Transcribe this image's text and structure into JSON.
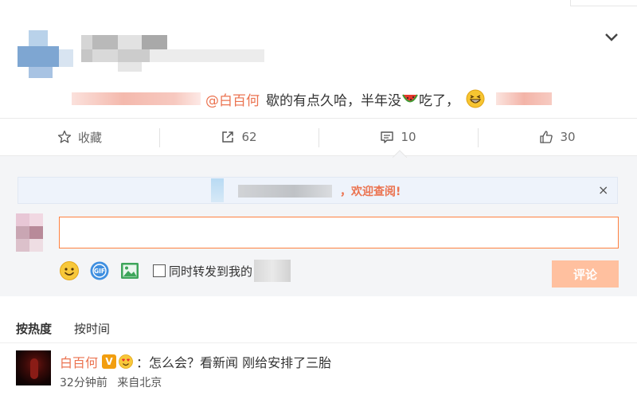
{
  "post": {
    "mention": "@白百何",
    "text_before_emoji": "歇的有点久哈，半年没",
    "emoji_watermelon": "watermelon-emoji",
    "text_after_emoji": "吃了，",
    "emoji_grin": "grin-emoji"
  },
  "actions": {
    "favorite_label": "收藏",
    "share_count": "62",
    "comment_count": "10",
    "like_count": "30"
  },
  "comment_box": {
    "notice_text": "，欢迎查阅!",
    "notice_close": "×",
    "input_value": "",
    "input_placeholder": "",
    "forward_label": "同时转发到我的",
    "submit_label": "评论"
  },
  "sort": {
    "hot_label": "按热度",
    "time_label": "按时间"
  },
  "comment": {
    "author": "白百何",
    "badge": "V",
    "text": "：怎么会？看新闻 刚给安排了三胎",
    "time": "32分钟前",
    "source": "来自北京"
  },
  "colors": {
    "accent": "#eb7350",
    "input_border": "#ff8140",
    "submit_bg": "#ffc09f",
    "verified": "#f29e0f"
  }
}
